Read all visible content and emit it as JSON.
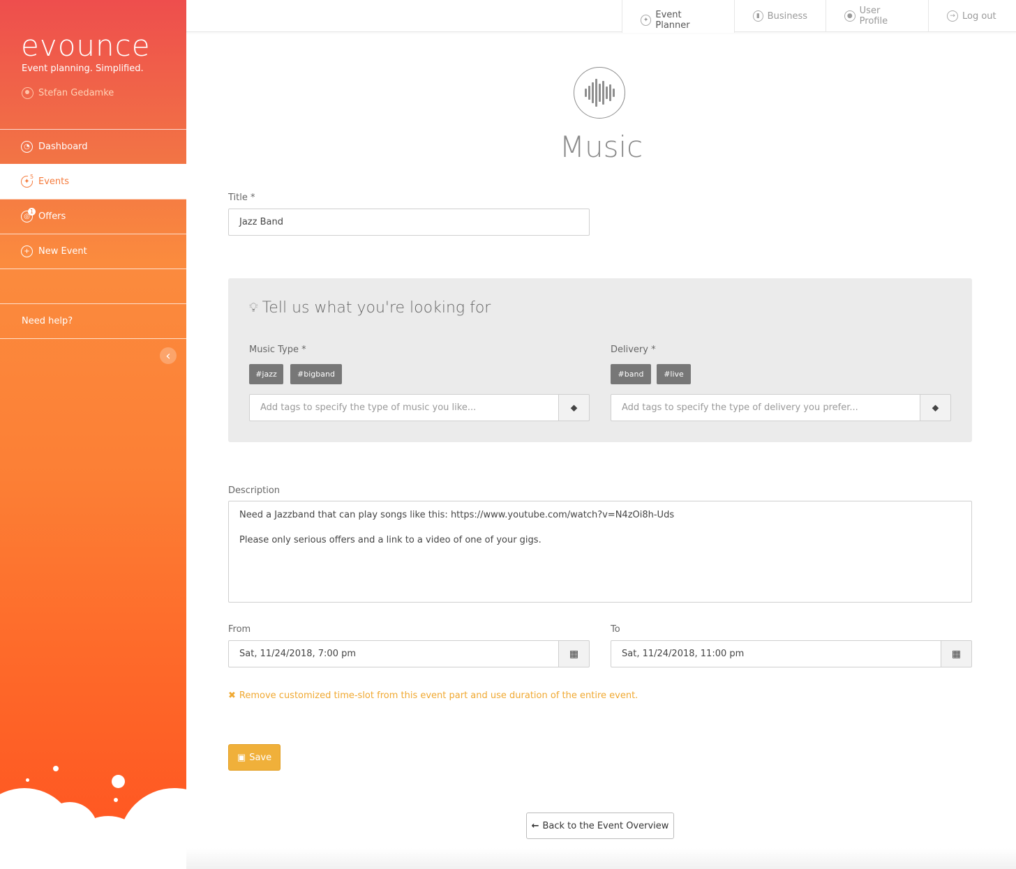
{
  "brand": {
    "logo_text": "evounce",
    "tagline": "Event planning. Simplified.",
    "user_name": "Stefan Gedamke",
    "primary_color": "#f57b3c",
    "accent_color": "#f0b03a"
  },
  "sidebar": {
    "items": [
      {
        "label": "Dashboard",
        "icon": "dashboard-icon",
        "active": false
      },
      {
        "label": "Events",
        "icon": "events-icon",
        "active": true,
        "badge": "5"
      },
      {
        "label": "Offers",
        "icon": "offers-icon",
        "active": false,
        "badge": "1"
      },
      {
        "label": "New Event",
        "icon": "plus-icon",
        "active": false
      }
    ],
    "help_label": "Need help?"
  },
  "topnav": {
    "tabs": [
      {
        "label": "Event Planner",
        "icon": "planner-icon",
        "active": true
      },
      {
        "label": "Business",
        "icon": "chart-icon",
        "active": false
      },
      {
        "label": "User Profile",
        "icon": "user-icon",
        "active": false
      },
      {
        "label": "Log out",
        "icon": "logout-icon",
        "active": false
      }
    ]
  },
  "page": {
    "icon": "music-wave-icon",
    "title": "Music"
  },
  "form": {
    "title_label": "Title *",
    "title_value": "Jazz Band",
    "panel_title": "Tell us what you're looking for",
    "music_type": {
      "label": "Music Type *",
      "tags": [
        "#jazz",
        "#bigband"
      ],
      "placeholder": "Add tags to specify the type of music you like..."
    },
    "delivery": {
      "label": "Delivery *",
      "tags": [
        "#band",
        "#live"
      ],
      "placeholder": "Add tags to specify the type of delivery you prefer..."
    },
    "description_label": "Description",
    "description_lines": [
      "Need a Jazzband that can play songs like this: https://www.youtube.com/watch?v=N4zOi8h-Uds",
      "Please only serious offers and a link to a video of one of your gigs."
    ],
    "from_label": "From",
    "from_value": "Sat, 11/24/2018, 7:00 pm",
    "to_label": "To",
    "to_value": "Sat, 11/24/2018, 11:00 pm",
    "remove_slot_text": "Remove customized time-slot from this event part and use duration of the entire event.",
    "save_label": "Save",
    "back_label": "Back to the Event Overview"
  }
}
